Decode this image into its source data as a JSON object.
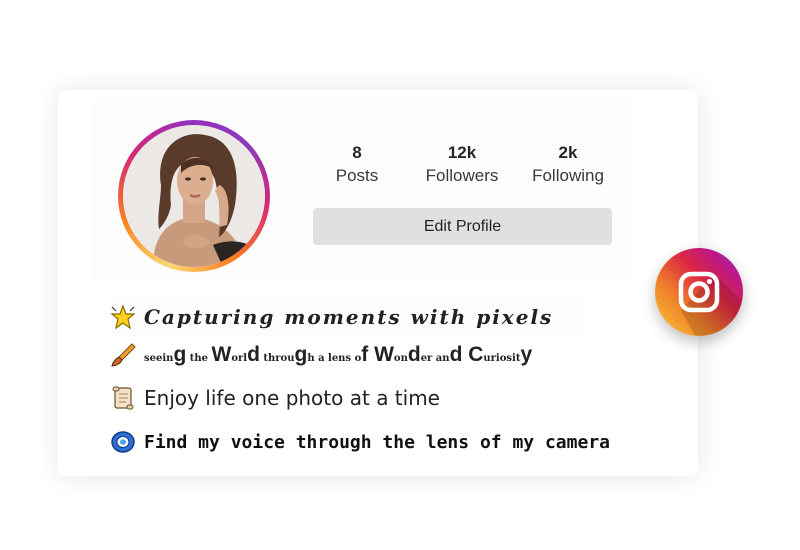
{
  "profile": {
    "stats": [
      {
        "value": "8",
        "label": "Posts"
      },
      {
        "value": "12k",
        "label": "Followers"
      },
      {
        "value": "2k",
        "label": "Following"
      }
    ],
    "edit_button": "Edit Profile"
  },
  "bio": {
    "line1": "Capturing moments with pixels",
    "line2_parts": [
      {
        "t": "seein",
        "big": false
      },
      {
        "t": "g",
        "big": true
      },
      {
        "t": " the ",
        "big": false
      },
      {
        "t": "W",
        "big": true
      },
      {
        "t": "orl",
        "big": false
      },
      {
        "t": "d",
        "big": true
      },
      {
        "t": " throu",
        "big": false
      },
      {
        "t": "g",
        "big": true
      },
      {
        "t": "h a lens o",
        "big": false
      },
      {
        "t": "f W",
        "big": true
      },
      {
        "t": "on",
        "big": false
      },
      {
        "t": "d",
        "big": true
      },
      {
        "t": "er an",
        "big": false
      },
      {
        "t": "d C",
        "big": true
      },
      {
        "t": "uriosit",
        "big": false
      },
      {
        "t": "y",
        "big": true
      }
    ],
    "line3": "Enjoy life one photo at a time",
    "line4": "Find my voice through the lens of my camera"
  },
  "icons": {
    "line1": "glowing-star-icon",
    "line2": "paintbrush-icon",
    "line3": "scroll-icon",
    "line4": "camera-lens-icon",
    "badge": "instagram-logo-icon"
  },
  "colors": {
    "ring_gradient": [
      "#feda75",
      "#fa7e1e",
      "#d62976",
      "#962fbf"
    ],
    "button_bg": "#e0e0e0"
  }
}
